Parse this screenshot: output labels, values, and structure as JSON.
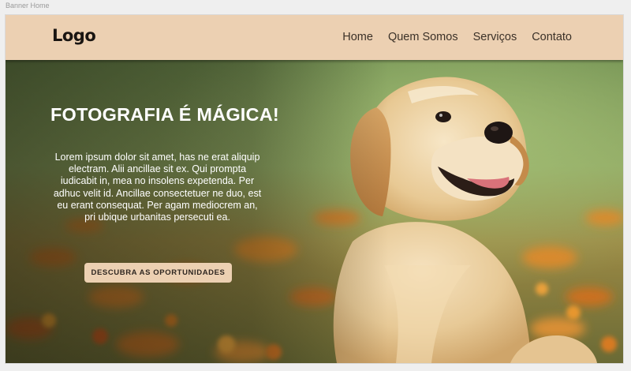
{
  "frame": {
    "label": "Banner Home"
  },
  "header": {
    "logo": "Logo",
    "nav": [
      "Home",
      "Quem Somos",
      "Serviços",
      "Contato"
    ]
  },
  "hero": {
    "title": "FOTOGRAFIA É MÁGICA!",
    "text": "Lorem ipsum dolor sit amet, has ne erat aliquip electram. Alii ancillae sit ex. Qui prompta iudicabit in, mea no insolens expetenda. Per adhuc velit id. Ancillae consectetuer ne duo, est eu erant consequat. Per agam mediocrem an, pri ubique urbanitas persecuti ea.",
    "button_label": "DESCUBRA AS OPORTUNIDADES",
    "image": "golden-retriever-puppy-in-flower-field"
  },
  "colors": {
    "header_bg": "#ecd0b2",
    "button_bg": "#ecd0b2",
    "text_dark": "#3b3128",
    "hero_text": "#ffffff"
  }
}
